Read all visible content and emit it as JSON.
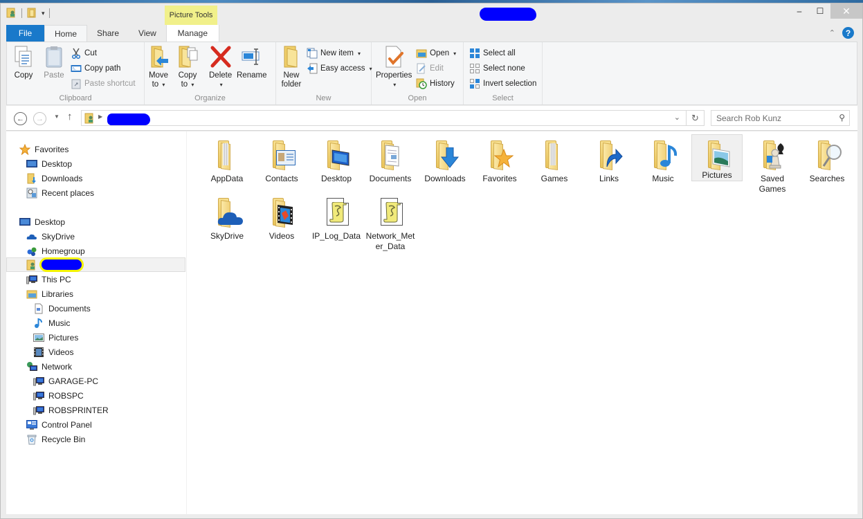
{
  "window": {
    "title_redacted": true,
    "context_tab_group": "Picture Tools",
    "controls": {
      "minimize": "–",
      "maximize": "☐",
      "close": "✕"
    }
  },
  "ribbon": {
    "tabs": [
      {
        "id": "file",
        "label": "File"
      },
      {
        "id": "home",
        "label": "Home",
        "active": true
      },
      {
        "id": "share",
        "label": "Share"
      },
      {
        "id": "view",
        "label": "View"
      },
      {
        "id": "manage",
        "label": "Manage"
      }
    ],
    "groups": {
      "clipboard": {
        "label": "Clipboard",
        "copy": "Copy",
        "paste": "Paste",
        "cut": "Cut",
        "copy_path": "Copy path",
        "paste_shortcut": "Paste shortcut"
      },
      "organize": {
        "label": "Organize",
        "move_to_1": "Move",
        "move_to_2": "to",
        "copy_to_1": "Copy",
        "copy_to_2": "to",
        "delete": "Delete",
        "rename": "Rename"
      },
      "new": {
        "label": "New",
        "new_folder_1": "New",
        "new_folder_2": "folder",
        "new_item": "New item",
        "easy_access": "Easy access"
      },
      "open": {
        "label": "Open",
        "properties": "Properties",
        "open": "Open",
        "edit": "Edit",
        "history": "History"
      },
      "select": {
        "label": "Select",
        "select_all": "Select all",
        "select_none": "Select none",
        "invert_selection": "Invert selection"
      }
    }
  },
  "navigation": {
    "address_redacted": true,
    "search_placeholder": "Search Rob Kunz"
  },
  "nav_pane": {
    "items": [
      {
        "label": "Favorites",
        "icon": "star-icon",
        "level": 0
      },
      {
        "label": "Desktop",
        "icon": "desktop-icon",
        "level": 1
      },
      {
        "label": "Downloads",
        "icon": "downloads-folder-icon",
        "level": 1
      },
      {
        "label": "Recent places",
        "icon": "recent-places-icon",
        "level": 1
      },
      {
        "label": "Desktop",
        "icon": "desktop-icon",
        "level": 0
      },
      {
        "label": "SkyDrive",
        "icon": "skydrive-cloud-icon",
        "level": 1
      },
      {
        "label": "Homegroup",
        "icon": "homegroup-icon",
        "level": 1
      },
      {
        "label": "",
        "icon": "user-folder-icon",
        "level": 1,
        "selected": true,
        "redacted": true
      },
      {
        "label": "This PC",
        "icon": "computer-icon",
        "level": 1
      },
      {
        "label": "Libraries",
        "icon": "libraries-icon",
        "level": 1
      },
      {
        "label": "Documents",
        "icon": "document-icon",
        "level": 2
      },
      {
        "label": "Music",
        "icon": "music-note-icon",
        "level": 2
      },
      {
        "label": "Pictures",
        "icon": "picture-icon",
        "level": 2
      },
      {
        "label": "Videos",
        "icon": "film-icon",
        "level": 2
      },
      {
        "label": "Network",
        "icon": "network-icon",
        "level": 1
      },
      {
        "label": "GARAGE-PC",
        "icon": "computer-icon",
        "level": 2
      },
      {
        "label": "ROBSPC",
        "icon": "computer-icon",
        "level": 2
      },
      {
        "label": "ROBSPRINTER",
        "icon": "computer-icon",
        "level": 2
      },
      {
        "label": "Control Panel",
        "icon": "control-panel-icon",
        "level": 1
      },
      {
        "label": "Recycle Bin",
        "icon": "recycle-bin-icon",
        "level": 1
      }
    ]
  },
  "files": [
    {
      "name": "AppData",
      "type": "folder",
      "overlay": "none"
    },
    {
      "name": "Contacts",
      "type": "folder",
      "overlay": "contact-card"
    },
    {
      "name": "Desktop",
      "type": "folder",
      "overlay": "monitor"
    },
    {
      "name": "Documents",
      "type": "folder",
      "overlay": "document"
    },
    {
      "name": "Downloads",
      "type": "folder",
      "overlay": "down-arrow"
    },
    {
      "name": "Favorites",
      "type": "folder",
      "overlay": "star"
    },
    {
      "name": "Games",
      "type": "folder",
      "overlay": "none"
    },
    {
      "name": "Links",
      "type": "folder",
      "overlay": "link-arrow"
    },
    {
      "name": "Music",
      "type": "folder",
      "overlay": "music-note"
    },
    {
      "name": "Pictures",
      "type": "folder",
      "overlay": "picture",
      "selected": true
    },
    {
      "name": "Saved Games",
      "type": "folder",
      "overlay": "chess-piece"
    },
    {
      "name": "Searches",
      "type": "folder",
      "overlay": "magnifier"
    },
    {
      "name": "SkyDrive",
      "type": "folder",
      "overlay": "cloud"
    },
    {
      "name": "Videos",
      "type": "folder",
      "overlay": "film"
    },
    {
      "name": "IP_Log_Data",
      "type": "script",
      "overlay": "scroll"
    },
    {
      "name": "Network_Meter_Data",
      "type": "script",
      "overlay": "scroll"
    }
  ],
  "colors": {
    "file_tab": "#1979ca",
    "context_tab": "#f1f08a",
    "redaction": "#0000ff",
    "highlight": "#f4f400"
  }
}
